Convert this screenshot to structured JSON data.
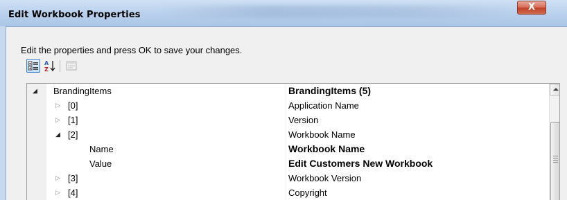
{
  "window": {
    "title": "Edit Workbook Properties",
    "close_label": "X"
  },
  "dialog": {
    "instruction": "Edit the properties and press OK to save your changes."
  },
  "toolbar": {
    "categorized_icon": "categorized-view-icon",
    "alphabetical_icon": "sort-alphabetical-icon",
    "property_pages_icon": "property-pages-icon"
  },
  "grid": {
    "rows": [
      {
        "name": "BrandingItems",
        "value": "BrandingItems (5)",
        "value_bold": true,
        "expander": "open"
      },
      {
        "name": "[0]",
        "value": "Application Name",
        "value_bold": false,
        "expander": "closed"
      },
      {
        "name": "[1]",
        "value": "Version",
        "value_bold": false,
        "expander": "closed"
      },
      {
        "name": "[2]",
        "value": "Workbook Name",
        "value_bold": false,
        "expander": "open"
      },
      {
        "name": "Name",
        "value": "Workbook Name",
        "value_bold": true,
        "expander": "none"
      },
      {
        "name": "Value",
        "value": "Edit Customers New Workbook",
        "value_bold": true,
        "expander": "none"
      },
      {
        "name": "[3]",
        "value": "Workbook Version",
        "value_bold": false,
        "expander": "closed"
      },
      {
        "name": "[4]",
        "value": "Copyright",
        "value_bold": false,
        "expander": "closed"
      }
    ]
  },
  "colors": {
    "titlebar": "#bcd3ee",
    "close_button": "#c0432b",
    "dialog_bg": "#f0f0f0"
  }
}
